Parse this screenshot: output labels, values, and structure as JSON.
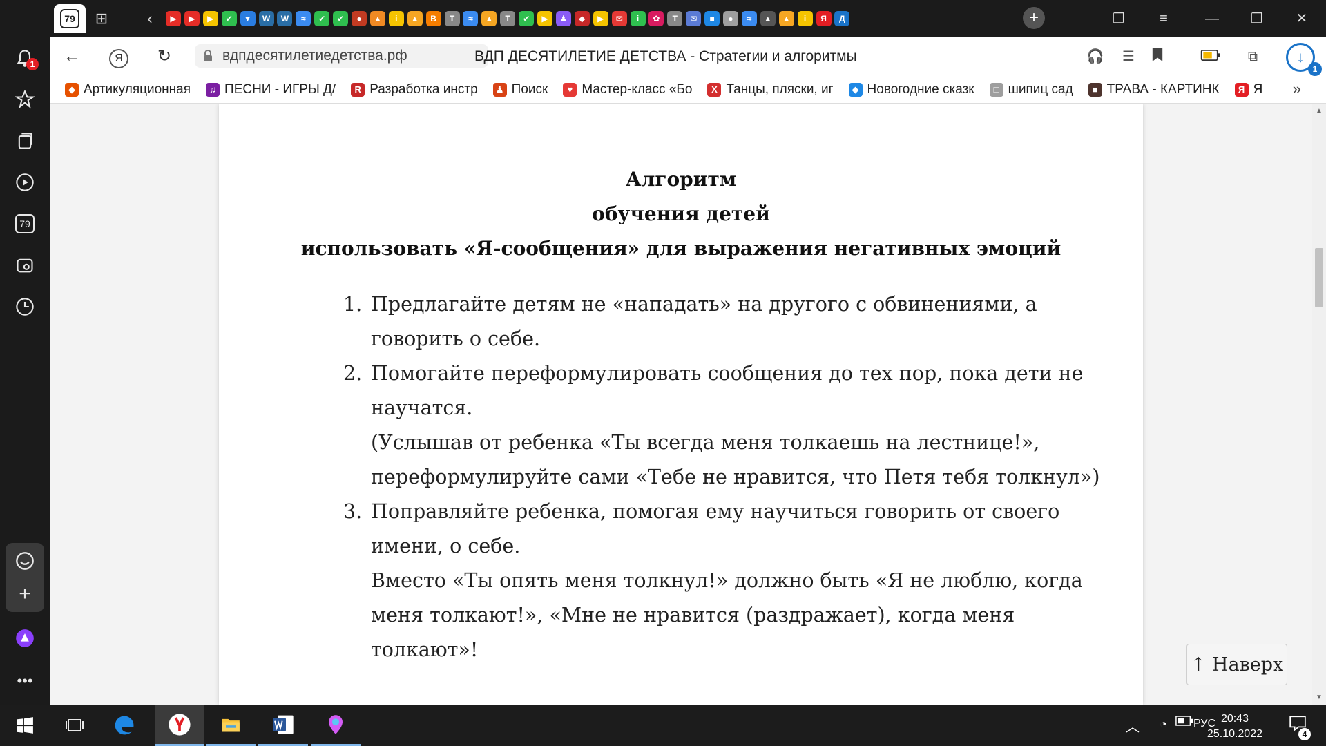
{
  "tabstrip": {
    "counter_tab": "79",
    "favicons": [
      {
        "name": "youtube",
        "color": "#e52d27",
        "glyph": "▶"
      },
      {
        "name": "youtube",
        "color": "#e52d27",
        "glyph": "▶"
      },
      {
        "name": "play",
        "color": "#f5c400",
        "glyph": "▶"
      },
      {
        "name": "check",
        "color": "#2fbf4f",
        "glyph": "✔"
      },
      {
        "name": "shield",
        "color": "#2a7de1",
        "glyph": "▼"
      },
      {
        "name": "wordpress",
        "color": "#2a6ea6",
        "glyph": "W"
      },
      {
        "name": "wordpress",
        "color": "#2a6ea6",
        "glyph": "W"
      },
      {
        "name": "wave",
        "color": "#3b8bf0",
        "glyph": "≈"
      },
      {
        "name": "check",
        "color": "#2fbf4f",
        "glyph": "✔"
      },
      {
        "name": "check",
        "color": "#2fbf4f",
        "glyph": "✔"
      },
      {
        "name": "apple",
        "color": "#c23b22",
        "glyph": "●"
      },
      {
        "name": "pizza",
        "color": "#f08a24",
        "glyph": "▲"
      },
      {
        "name": "info",
        "color": "#f5c400",
        "glyph": "i"
      },
      {
        "name": "picture",
        "color": "#f5a623",
        "glyph": "▲"
      },
      {
        "name": "blogger",
        "color": "#f57d00",
        "glyph": "B"
      },
      {
        "name": "t-circle",
        "color": "#888888",
        "glyph": "T"
      },
      {
        "name": "wave",
        "color": "#3b8bf0",
        "glyph": "≈"
      },
      {
        "name": "picture",
        "color": "#f5a623",
        "glyph": "▲"
      },
      {
        "name": "t-circle",
        "color": "#888888",
        "glyph": "T"
      },
      {
        "name": "check",
        "color": "#2fbf4f",
        "glyph": "✔"
      },
      {
        "name": "play",
        "color": "#f5c400",
        "glyph": "▶"
      },
      {
        "name": "person",
        "color": "#8a5cf6",
        "glyph": "♟"
      },
      {
        "name": "car",
        "color": "#c62828",
        "glyph": "◆"
      },
      {
        "name": "play",
        "color": "#f5c400",
        "glyph": "▶"
      },
      {
        "name": "mail",
        "color": "#e53935",
        "glyph": "✉"
      },
      {
        "name": "info",
        "color": "#2fbf4f",
        "glyph": "i"
      },
      {
        "name": "flower",
        "color": "#d81b60",
        "glyph": "✿"
      },
      {
        "name": "t-circle",
        "color": "#888888",
        "glyph": "T"
      },
      {
        "name": "envelope",
        "color": "#5b7bd5",
        "glyph": "✉"
      },
      {
        "name": "chat",
        "color": "#1e88e5",
        "glyph": "■"
      },
      {
        "name": "cloud",
        "color": "#9e9e9e",
        "glyph": "●"
      },
      {
        "name": "wave",
        "color": "#3b8bf0",
        "glyph": "≈"
      },
      {
        "name": "mountain",
        "color": "#555555",
        "glyph": "▲"
      },
      {
        "name": "picture",
        "color": "#f5a623",
        "glyph": "▲"
      },
      {
        "name": "info",
        "color": "#f5c400",
        "glyph": "i"
      },
      {
        "name": "yandex",
        "color": "#e31e24",
        "glyph": "Я"
      },
      {
        "name": "d-letter",
        "color": "#1a73c8",
        "glyph": "Д"
      }
    ]
  },
  "toolbar": {
    "url": "вдпдесятилетиедетства.рф",
    "page_title": "ВДП ДЕСЯТИЛЕТИЕ ДЕТСТВА - Стратегии и алгоритмы",
    "downloads_count": "1",
    "yandex_glyph": "Я"
  },
  "sidebar": {
    "notifications_count": "1",
    "tabs_count": "79"
  },
  "bookmarks": [
    {
      "label": "Артикуляционная",
      "color": "#e65100",
      "glyph": "◆"
    },
    {
      "label": "ПЕСНИ - ИГРЫ Д/",
      "color": "#7b1fa2",
      "glyph": "♫"
    },
    {
      "label": "Разработка инстр",
      "color": "#c62828",
      "glyph": "R"
    },
    {
      "label": "Поиск",
      "color": "#d84315",
      "glyph": "♟"
    },
    {
      "label": "Мастер-класс «Бо",
      "color": "#e53935",
      "glyph": "♥"
    },
    {
      "label": "Танцы, пляски, иг",
      "color": "#d32f2f",
      "glyph": "X"
    },
    {
      "label": "Новогодние сказк",
      "color": "#1e88e5",
      "glyph": "◆"
    },
    {
      "label": "шипиц сад",
      "color": "#9e9e9e",
      "glyph": "□"
    },
    {
      "label": "ТРАВА - КАРТИНК",
      "color": "#4e342e",
      "glyph": "■"
    },
    {
      "label": "Я",
      "color": "#e31e24",
      "glyph": "Я"
    }
  ],
  "document": {
    "heading": [
      "Алгоритм",
      "обучения детей",
      "использовать «Я-сообщения» для выражения негативных эмоций"
    ],
    "items": [
      {
        "number": "1.",
        "lines": [
          "Предлагайте детям не «нападать» на другого с обвинениями, а говорить о себе."
        ]
      },
      {
        "number": "2.",
        "lines": [
          "Помогайте переформулировать сообщения до тех пор, пока дети не научатся.",
          "(Услышав от ребенка «Ты всегда меня толкаешь на лестнице!», переформулируйте сами «Тебе не нравится, что Петя тебя толкнул»)"
        ]
      },
      {
        "number": "3.",
        "lines": [
          "Поправляйте ребенка, помогая ему научиться говорить от своего имени, о себе.",
          "Вместо «Ты опять меня толкнул!» должно быть «Я не люблю, когда меня толкают!», «Мне не нравится (раздражает), когда меня толкают»!"
        ]
      }
    ],
    "scroll_top_button": "↑ Наверх"
  },
  "taskbar": {
    "language": "РУС",
    "time": "20:43",
    "date": "25.10.2022",
    "notifications_count": "4"
  }
}
